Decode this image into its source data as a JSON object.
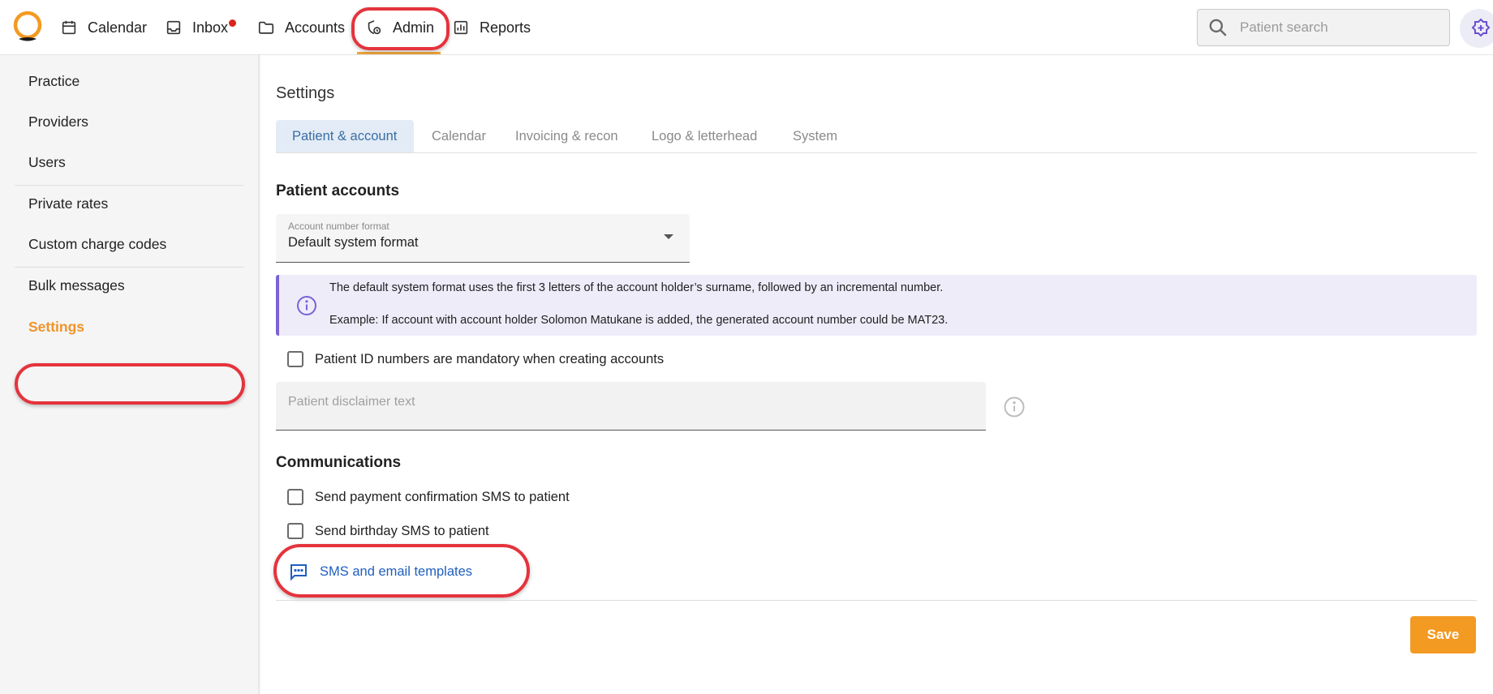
{
  "colors": {
    "accent": "#f39a22",
    "active_sidebar": "#f0942a",
    "link": "#1f5fbf",
    "annotation": "#e5333c",
    "info_banner_bg": "#eeecf9",
    "info_banner_border": "#7b62d6",
    "notification_dot": "#d9251c"
  },
  "topnav": {
    "logo_icon": "app-logo-icon",
    "items": [
      {
        "label": "Calendar",
        "icon": "calendar-icon"
      },
      {
        "label": "Inbox",
        "icon": "inbox-icon",
        "has_notification": true
      },
      {
        "label": "Accounts",
        "icon": "folder-icon"
      },
      {
        "label": "Admin",
        "icon": "admin-icon",
        "active": true
      },
      {
        "label": "Reports",
        "icon": "chart-icon"
      }
    ],
    "search": {
      "placeholder": "Patient search",
      "value": ""
    },
    "avatar_icon": "medical-badge-icon"
  },
  "sidebar": {
    "items": [
      {
        "label": "Practice"
      },
      {
        "label": "Providers"
      },
      {
        "label": "Users"
      },
      {
        "label": "Private rates"
      },
      {
        "label": "Custom charge codes"
      },
      {
        "label": "Bulk messages"
      },
      {
        "label": "Settings",
        "active": true
      }
    ]
  },
  "main": {
    "title": "Settings",
    "tabs": [
      {
        "label": "Patient & account",
        "active": true
      },
      {
        "label": "Calendar"
      },
      {
        "label": "Invoicing & recon"
      },
      {
        "label": "Logo & letterhead"
      },
      {
        "label": "System"
      }
    ],
    "patient_accounts": {
      "heading": "Patient accounts",
      "account_number_format": {
        "label": "Account number format",
        "value": "Default system format"
      },
      "info": {
        "line1": "The default system format uses the first 3 letters of the account holder’s surname, followed by an incremental number.",
        "line2": "Example: If account with account holder Solomon Matukane is added, the generated account number could be MAT23."
      },
      "id_mandatory_checkbox": {
        "label": "Patient ID numbers are mandatory when creating accounts",
        "checked": false
      },
      "disclaimer": {
        "placeholder": "Patient disclaimer text",
        "value": ""
      }
    },
    "communications": {
      "heading": "Communications",
      "payment_sms": {
        "label": "Send payment confirmation SMS to patient",
        "checked": false
      },
      "birthday_sms": {
        "label": "Send birthday SMS to patient",
        "checked": false
      },
      "templates_link": {
        "label": "SMS and email templates",
        "icon": "message-icon"
      }
    },
    "save_label": "Save"
  }
}
